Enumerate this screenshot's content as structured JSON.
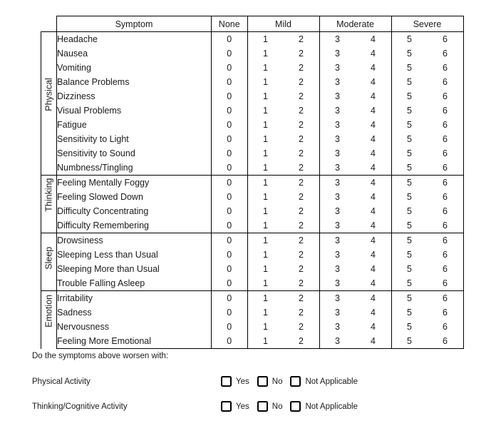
{
  "table": {
    "headers": {
      "category": "",
      "symptom": "Symptom",
      "none": "None",
      "mild": "Mild",
      "moderate": "Moderate",
      "severe": "Severe"
    },
    "scale": [
      "0",
      "1",
      "2",
      "3",
      "4",
      "5",
      "6"
    ],
    "sections": [
      {
        "category": "Physical",
        "symptoms": [
          "Headache",
          "Nausea",
          "Vomiting",
          "Balance Problems",
          "Dizziness",
          "Visual Problems",
          "Fatigue",
          "Sensitivity to Light",
          "Sensitivity to Sound",
          "Numbness/Tingling"
        ]
      },
      {
        "category": "Thinking",
        "symptoms": [
          "Feeling Mentally Foggy",
          "Feeling Slowed Down",
          "Difficulty Concentrating",
          "Difficulty Remembering"
        ]
      },
      {
        "category": "Sleep",
        "symptoms": [
          "Drowsiness",
          "Sleeping Less than Usual",
          "Sleeping More than Usual",
          "Trouble Falling Asleep"
        ]
      },
      {
        "category": "Emotion",
        "symptoms": [
          "Irritability",
          "Sadness",
          "Nervousness",
          "Feeling More Emotional"
        ]
      }
    ]
  },
  "worsen": {
    "prompt": "Do the symptoms above worsen with:",
    "options": [
      "Yes",
      "No",
      "Not Applicable"
    ],
    "rows": [
      {
        "label": "Physical Activity"
      },
      {
        "label": "Thinking/Cognitive Activity"
      }
    ]
  }
}
